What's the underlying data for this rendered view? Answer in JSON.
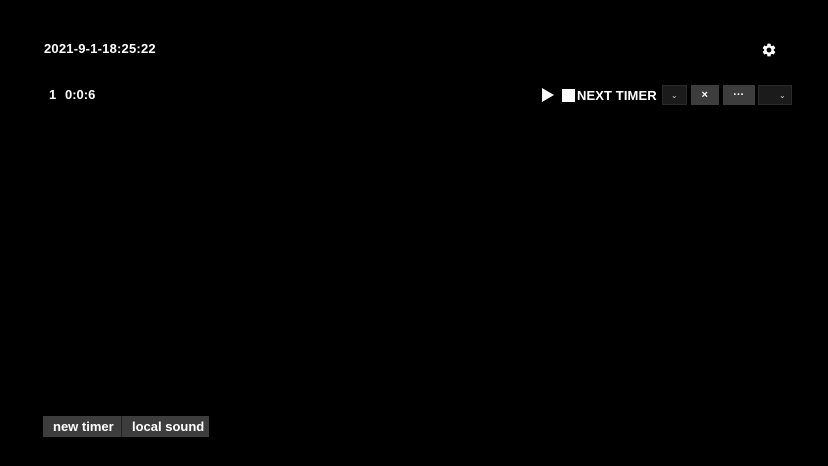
{
  "header": {
    "datetime": "2021-9-1-18:25:22",
    "settings_icon": "gear-icon"
  },
  "timer": {
    "index": "1",
    "time": "0:0:6",
    "name": "NEXT TIMER",
    "play_icon": "play-icon",
    "stop_icon": "stop-icon",
    "dropdown_glyph": "⌄",
    "close_label": "×",
    "more_label": "···",
    "dropdown2_glyph": "⌄"
  },
  "footer": {
    "new_timer_label": "new timer",
    "local_sound_label": "local sound"
  }
}
